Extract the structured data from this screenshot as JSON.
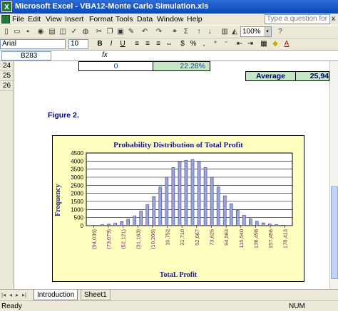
{
  "window": {
    "title": "Microsoft Excel - VBA12-Monte Carlo Simulation.xls",
    "app_icon_glyph": "X"
  },
  "menu": {
    "items": [
      "File",
      "Edit",
      "View",
      "Insert",
      "Format",
      "Tools",
      "Data",
      "Window",
      "Help"
    ],
    "help_placeholder": "Type a question for help",
    "close_glyph": "x"
  },
  "toolbar": {
    "zoom": "100%",
    "zoom_arrow": "▾",
    "sigma": "Σ"
  },
  "format_bar": {
    "font": "Arial",
    "size": "10",
    "bold": "B",
    "italic": "I",
    "underline": "U",
    "font_color": "A"
  },
  "formula_bar": {
    "name_box": "B283",
    "fx": "fx"
  },
  "sheet": {
    "rows": [
      {
        "num": "24",
        "cell_value": "0",
        "cell_percent": "22.28%"
      },
      {
        "num": "25",
        "label": "Average",
        "label_value": "25,94"
      },
      {
        "num": "26"
      }
    ],
    "figure_label": "Figure 2."
  },
  "chart_data": {
    "type": "bar",
    "title": "Probability Distribution of Total Profit",
    "xlabel": "TotaL Profit",
    "ylabel": "Frequency",
    "ylim": [
      0,
      4500
    ],
    "yticks": [
      0,
      500,
      1000,
      1500,
      2000,
      2500,
      3000,
      3500,
      4000,
      4500
    ],
    "grid": true,
    "category_labels": [
      "(94,036)",
      "(73,079)",
      "(52,121)",
      "(31,163)",
      "(10,206)",
      "10,752",
      "31,710",
      "52,667",
      "73,625",
      "94,583",
      "115,540",
      "136,498",
      "157,456",
      "178,413"
    ],
    "values": [
      5,
      20,
      60,
      90,
      150,
      250,
      400,
      600,
      900,
      1300,
      1800,
      2400,
      3000,
      3600,
      4000,
      4050,
      4100,
      4000,
      3600,
      3000,
      2400,
      1850,
      1350,
      950,
      650,
      420,
      270,
      170,
      100,
      60,
      30,
      15
    ],
    "colors": {
      "bar": "#9aa6d8",
      "bar_edge": "#2a2a7a",
      "plot_bg": "#ffffff",
      "grid": "#000000",
      "label": "#6b1f6b"
    }
  },
  "tabs": {
    "nav": [
      "|◂",
      "◂",
      "▸",
      "▸|"
    ],
    "active": "Introduction",
    "other": "Sheet1"
  },
  "status": {
    "left": "Ready",
    "right": "NUM"
  },
  "colors": {
    "average_bg": "#c4e8c4",
    "percent_bg": "#c4e8c4",
    "cell_text": "#1f3fbf"
  }
}
